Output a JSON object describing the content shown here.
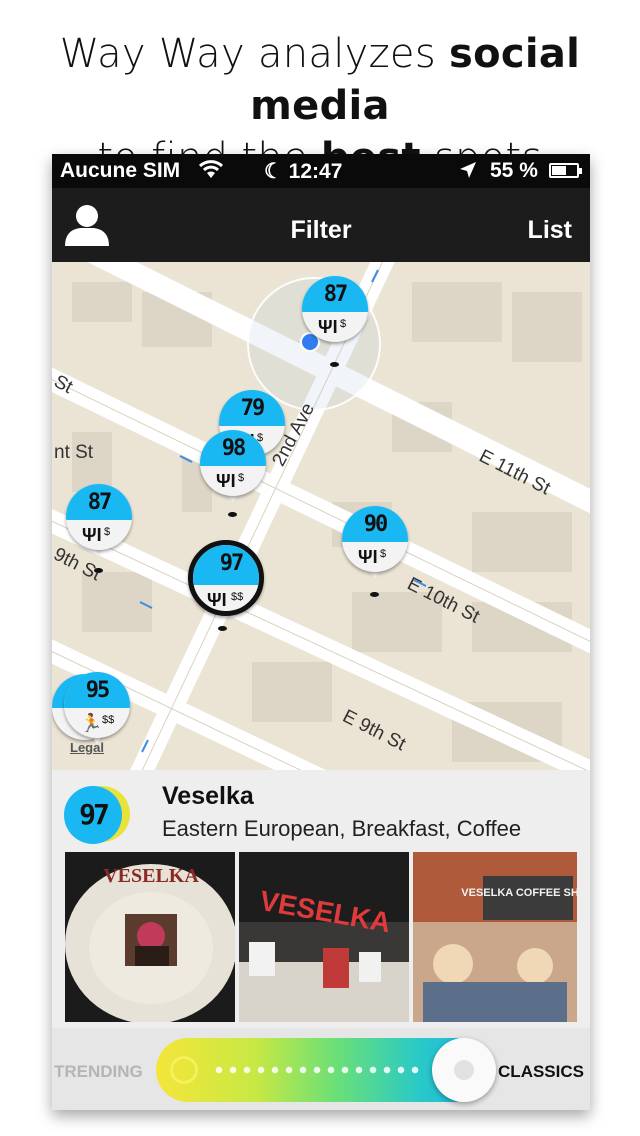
{
  "headline": {
    "line1_pre": "Way Way analyzes ",
    "line1_bold": "social media",
    "line2_pre": "to find the ",
    "line2_bold": "best",
    "line2_post": " spots"
  },
  "statusbar": {
    "carrier": "Aucune SIM",
    "time": "12:47",
    "battery": "55 %",
    "battery_level": 0.55
  },
  "navbar": {
    "title": "Filter",
    "list_label": "List",
    "profile_icon": "person-icon"
  },
  "map": {
    "streets": [
      "St",
      "nt St",
      "2nd Ave",
      "E 11th St",
      "9th St",
      "E 10th St",
      "E 9th St"
    ],
    "legal": "Legal",
    "pins": [
      {
        "score": "87",
        "price": "$",
        "icon": "fork-knife-icon"
      },
      {
        "score": "79",
        "price": "$",
        "icon": "fork-knife-icon"
      },
      {
        "score": "98",
        "price": "$",
        "icon": "fork-knife-icon"
      },
      {
        "score": "87",
        "price": "$",
        "icon": "fork-knife-icon"
      },
      {
        "score": "90",
        "price": "$",
        "icon": "fork-knife-icon"
      },
      {
        "score": "97",
        "price": "$$",
        "icon": "fork-knife-icon",
        "selected": true
      },
      {
        "score": "95",
        "price": "$$",
        "icon": "runner-icon"
      }
    ]
  },
  "detail": {
    "score": "97",
    "name": "Veselka",
    "tags": "Eastern European, Breakfast, Coffee",
    "photos": [
      {
        "caption": "VESELKA"
      },
      {
        "caption": "VESELKA"
      },
      {
        "caption": "VESELKA COFFEE SHOP"
      }
    ]
  },
  "slider": {
    "left_label": "TRENDING",
    "right_label": "CLASSICS",
    "value": 1.0
  }
}
